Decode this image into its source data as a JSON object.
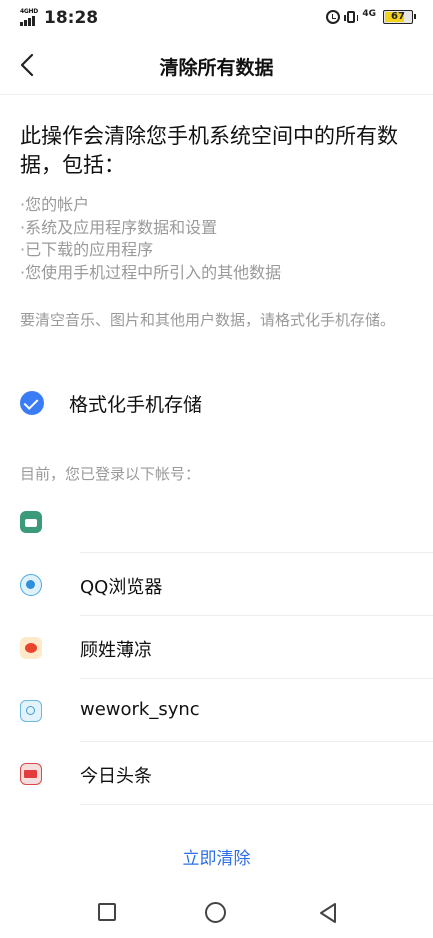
{
  "status_bar": {
    "network_label": "4GHD",
    "time": "18:28",
    "data_network": "4G",
    "battery_percent": "67"
  },
  "header": {
    "title": "清除所有数据"
  },
  "content": {
    "heading": "此操作会清除您手机系统空间中的所有数据，包括：",
    "bullets": [
      "·您的帐户",
      "·系统及应用程序数据和设置",
      "·已下载的应用程序",
      "·您使用手机过程中所引入的其他数据"
    ],
    "note": "要清空音乐、图片和其他用户数据，请格式化手机存储。",
    "format_option": {
      "label": "格式化手机存储",
      "checked": true
    },
    "accounts_label": "目前，您已登录以下帐号：",
    "accounts": [
      {
        "name": "",
        "icon": "android-app-icon"
      },
      {
        "name": "QQ浏览器",
        "icon": "qq-browser-icon"
      },
      {
        "name": "顾姓薄凉",
        "icon": "weibo-icon"
      },
      {
        "name": "wework_sync",
        "icon": "wework-sync-icon"
      },
      {
        "name": "今日头条",
        "icon": "toutiao-icon"
      }
    ]
  },
  "actions": {
    "clear_now": "立即清除"
  },
  "colors": {
    "accent": "#3a7cf6",
    "link": "#2f6fe6",
    "muted_text": "#9a9a9a",
    "battery": "#f2d21b"
  }
}
